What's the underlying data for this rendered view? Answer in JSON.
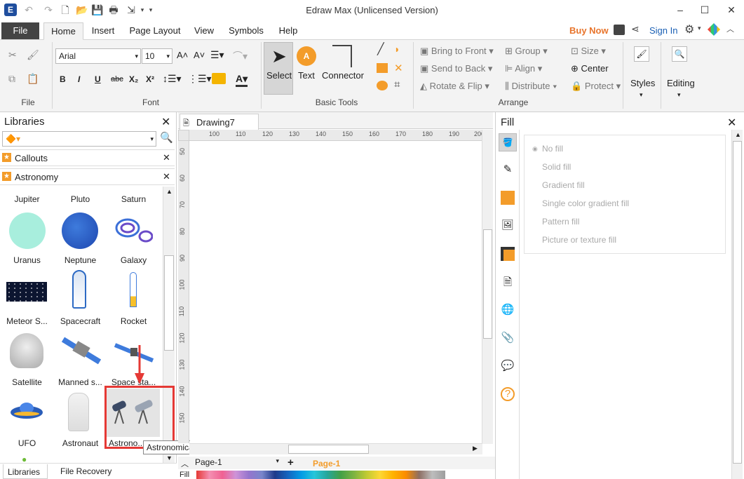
{
  "window": {
    "title": "Edraw Max (Unlicensed Version)"
  },
  "menu": {
    "file": "File",
    "tabs": [
      "Home",
      "Insert",
      "Page Layout",
      "View",
      "Symbols",
      "Help"
    ],
    "buy_now": "Buy Now",
    "sign_in": "Sign In"
  },
  "ribbon": {
    "font": {
      "family": "Arial",
      "size": "10"
    },
    "groups": {
      "file": "File",
      "font": "Font",
      "basic_tools": "Basic Tools",
      "arrange": "Arrange"
    },
    "tools": {
      "select": "Select",
      "text": "Text",
      "connector": "Connector"
    },
    "arrange": {
      "bring_to_front": "Bring to Front",
      "send_to_back": "Send to Back",
      "rotate_flip": "Rotate & Flip",
      "group": "Group",
      "align": "Align",
      "distribute": "Distribute",
      "size": "Size",
      "center": "Center",
      "protect": "Protect"
    },
    "styles": "Styles",
    "editing": "Editing"
  },
  "libraries": {
    "title": "Libraries",
    "sections": [
      "Callouts",
      "Astronomy"
    ],
    "shapes": [
      [
        "Jupiter",
        "Pluto",
        "Saturn"
      ],
      [
        "Uranus",
        "Neptune",
        "Galaxy"
      ],
      [
        "Meteor S...",
        "Spacecraft",
        "Rocket"
      ],
      [
        "Satellite",
        "Manned s...",
        "Space sta..."
      ],
      [
        "UFO",
        "Astronaut",
        "Astrono..."
      ]
    ],
    "tooltip": "Astronomical telescope",
    "bottom_tabs": [
      "Libraries",
      "File Recovery"
    ]
  },
  "document": {
    "tab": "Drawing7",
    "ruler_h": [
      "100",
      "110",
      "120",
      "130",
      "140",
      "150",
      "160",
      "170",
      "180",
      "190",
      "200"
    ],
    "ruler_v": [
      "50",
      "60",
      "70",
      "80",
      "90",
      "100",
      "110",
      "120",
      "130",
      "140",
      "150"
    ],
    "page_tab": "Page-1",
    "page_active": "Page-1",
    "fill_label": "Fill"
  },
  "fill_panel": {
    "title": "Fill",
    "options": [
      "No fill",
      "Solid fill",
      "Gradient fill",
      "Single color gradient fill",
      "Pattern fill",
      "Picture or texture fill"
    ]
  },
  "colors": {
    "accent": "#f39c2a",
    "buy": "#e8742b",
    "signin": "#1a5fb4",
    "highlight": "#e53935"
  }
}
